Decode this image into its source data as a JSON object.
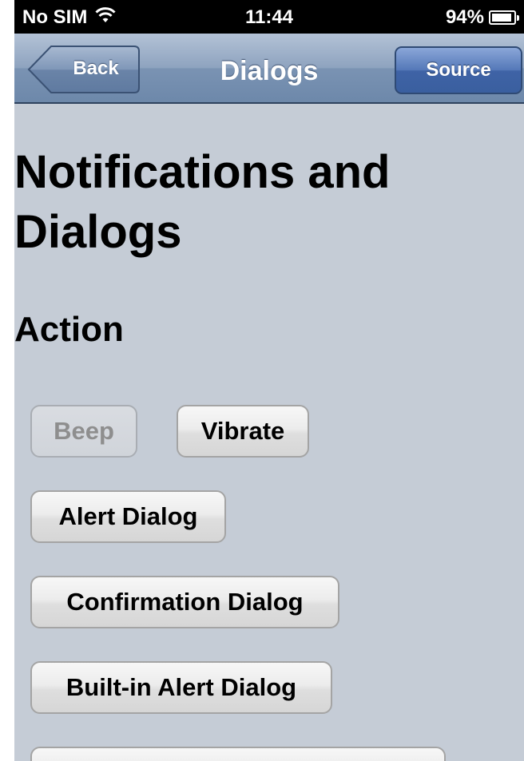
{
  "status_bar": {
    "carrier": "No SIM",
    "time": "11:44",
    "battery_percent": "94%",
    "battery_level": 0.94,
    "icons": [
      "wifi-icon",
      "battery-icon"
    ]
  },
  "nav_bar": {
    "back_label": "Back",
    "title": "Dialogs",
    "source_label": "Source"
  },
  "content": {
    "page_title": "Notifications and Dialogs",
    "section_heading": "Action",
    "buttons": {
      "beep": {
        "label": "Beep",
        "enabled": false
      },
      "vibrate": {
        "label": "Vibrate",
        "enabled": true
      },
      "alert_dialog": {
        "label": "Alert Dialog",
        "enabled": true
      },
      "confirmation_dialog": {
        "label": "Confirmation Dialog",
        "enabled": true
      },
      "builtin_alert_dialog": {
        "label": "Built-in Alert Dialog",
        "enabled": true
      }
    }
  },
  "colors": {
    "background": "#c5ccd6",
    "nav_bar": "#7a93b3",
    "source_button": "#3f63a6",
    "disabled_text": "#8e8e8e"
  }
}
